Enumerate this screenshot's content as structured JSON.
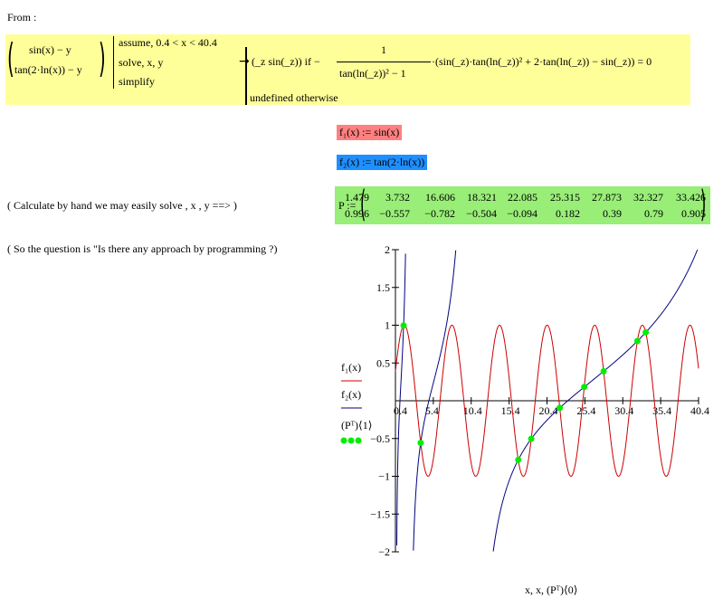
{
  "header": {
    "from_label": "From :"
  },
  "symbolic": {
    "vector": [
      "sin(x) − y",
      "tan(2·ln(x)) − y"
    ],
    "keywords": [
      "assume, 0.4 < x < 40.4",
      "solve, x, y",
      "simplify"
    ],
    "arrow": "→",
    "result_row1_left": "(_z   sin(_z))   if   −",
    "result_frac_num": "1",
    "result_frac_den": "tan(ln(_z))² − 1",
    "result_row1_right": "·(sin(_z)·tan(ln(_z))² + 2·tan(ln(_z)) − sin(_z)) = 0",
    "result_row2": "undefined   otherwise"
  },
  "definitions": {
    "f1": "f₁(x) := sin(x)",
    "f2": "f₂(x) := tan(2·ln(x))"
  },
  "notes": {
    "note1": "( Calculate by hand we may easily solve , x , y  ==> )",
    "note2": "( So the question is \"Is there any approach by programming ?)"
  },
  "matrix": {
    "label": "P :=",
    "row1": [
      "1.479",
      "3.732",
      "16.606",
      "18.321",
      "22.085",
      "25.315",
      "27.873",
      "32.327",
      "33.426"
    ],
    "row2": [
      "0.996",
      "−0.557",
      "−0.782",
      "−0.504",
      "−0.094",
      "0.182",
      "0.39",
      "0.79",
      "0.905"
    ]
  },
  "colors": {
    "f1": "#cc0000",
    "f2": "#000080",
    "points": "#00ee00",
    "highlight_yellow": "#ffff99",
    "f1_bg": "#ff8080",
    "f2_bg": "#1f8fff",
    "matrix_bg": "#99ee77"
  },
  "chart_data": {
    "type": "line",
    "xlim": [
      0.4,
      40.4
    ],
    "ylim": [
      -2,
      2
    ],
    "x_ticks": [
      "0.4",
      "5.4",
      "10.4",
      "15.4",
      "20.4",
      "25.4",
      "30.4",
      "35.4",
      "40.4"
    ],
    "y_ticks": [
      "2",
      "1.5",
      "1",
      "0.5",
      "−0.5",
      "−1",
      "−1.5",
      "−2"
    ],
    "legend": [
      "f₁(x)",
      "f₂(x)",
      "(Pᵀ)⟨1⟩"
    ],
    "xlabel": "x, x, (Pᵀ)⟨0⟩",
    "series": [
      {
        "name": "f₁(x)",
        "function": "sin(x)",
        "color": "#cc0000"
      },
      {
        "name": "f₂(x)",
        "function": "tan(2·ln(x))",
        "color": "#000080"
      },
      {
        "name": "(Pᵀ)⟨1⟩",
        "type": "scatter",
        "color": "#00ee00",
        "x": [
          1.479,
          3.732,
          16.606,
          18.321,
          22.085,
          25.315,
          27.873,
          32.327,
          33.426
        ],
        "y": [
          0.996,
          -0.557,
          -0.782,
          -0.504,
          -0.094,
          0.182,
          0.39,
          0.79,
          0.905
        ]
      }
    ]
  }
}
